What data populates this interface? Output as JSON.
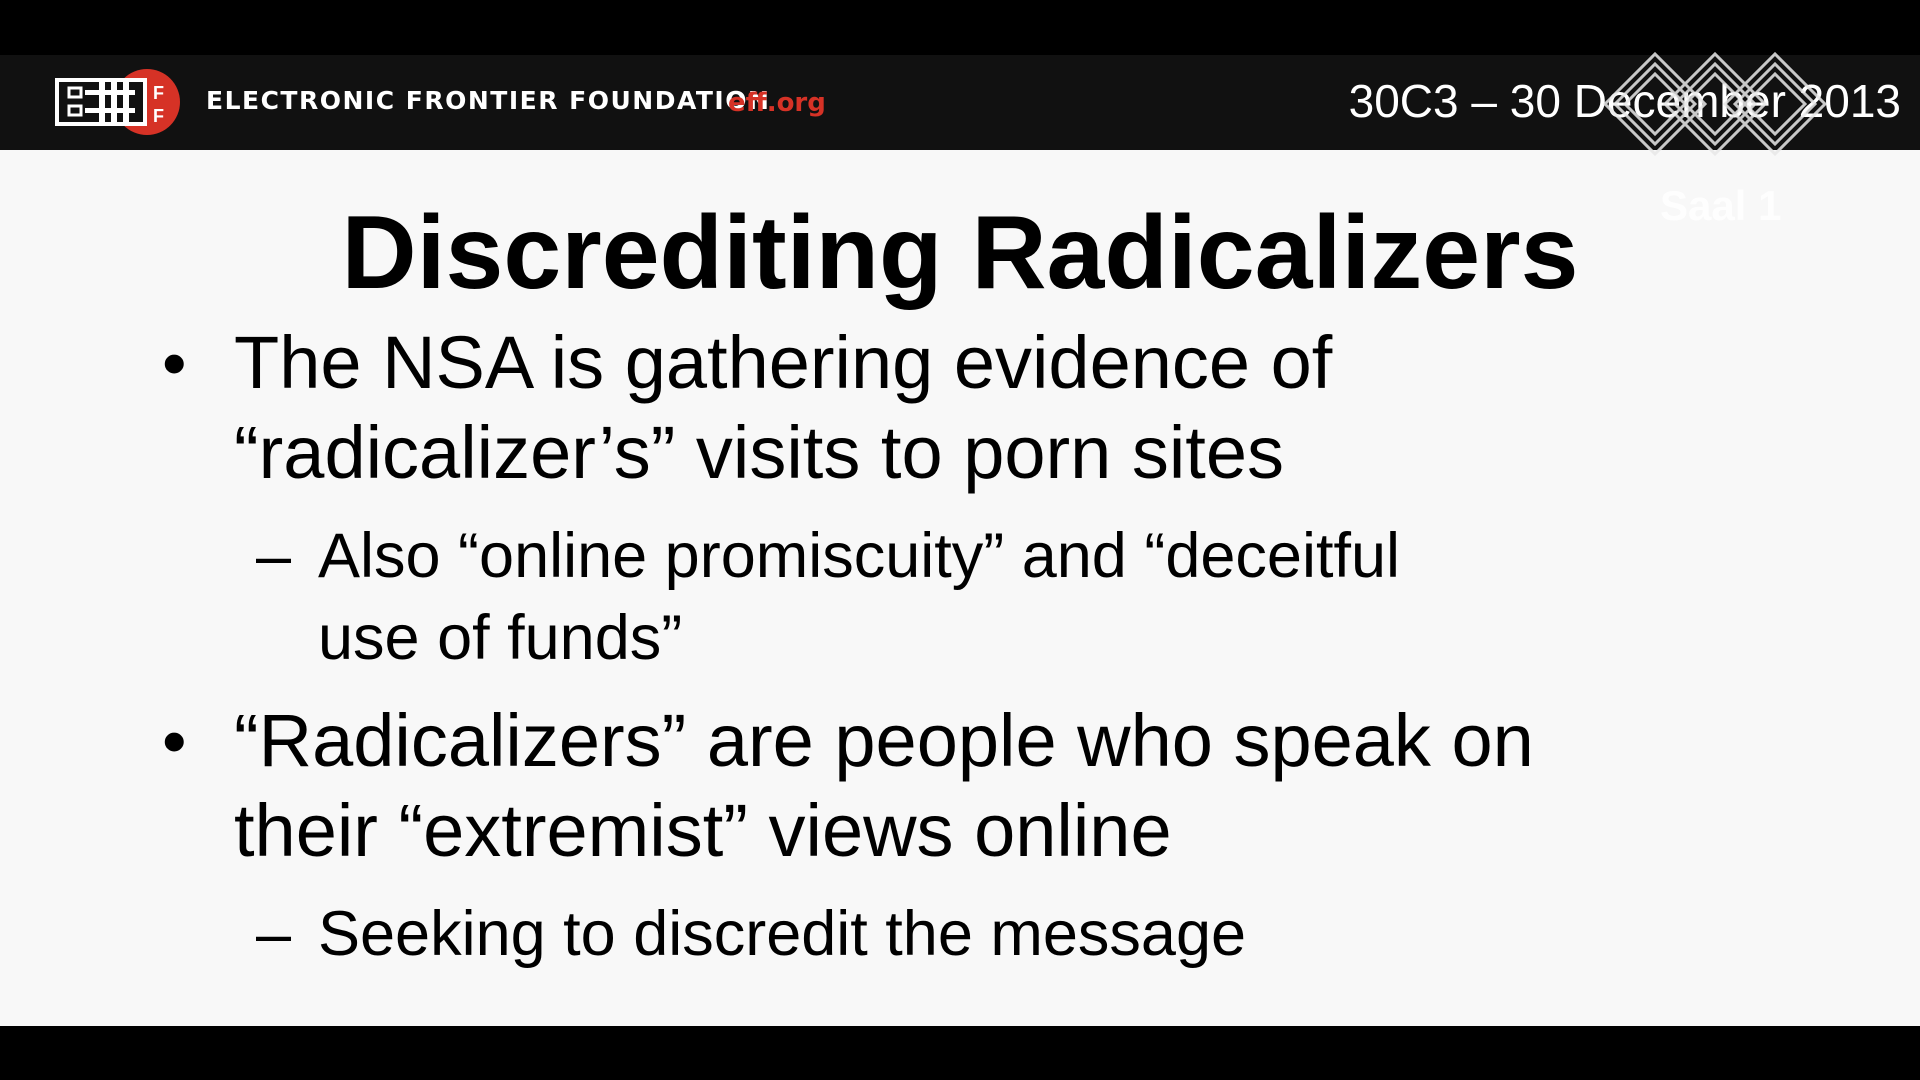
{
  "header": {
    "org_name": "ELECTRONIC FRONTIER FOUNDATION",
    "org_url": "eff.org",
    "event_label": "30C3 – 30 December 2013",
    "logo_icon": "eff-logo-icon",
    "watermark_icon": "ccc-diamond-watermark-icon",
    "ghost_text": "Saal 1"
  },
  "slide": {
    "title": "Discrediting Radicalizers",
    "bullets": [
      {
        "marker": "•",
        "lines": [
          "The NSA is gathering evidence of",
          "“radicalizer’s” visits to porn sites"
        ],
        "sub": {
          "marker": "–",
          "lines": [
            "Also “online promiscuity” and “deceitful",
            "use of funds”"
          ]
        }
      },
      {
        "marker": "•",
        "lines": [
          "“Radicalizers” are people who speak on",
          "their “extremist” views online"
        ],
        "sub": {
          "marker": "–",
          "lines": [
            "Seeking to discredit the message"
          ]
        }
      }
    ]
  },
  "colors": {
    "brand_red": "#d63226",
    "header_bg": "#111111",
    "slide_bg": "#f8f8f8"
  }
}
